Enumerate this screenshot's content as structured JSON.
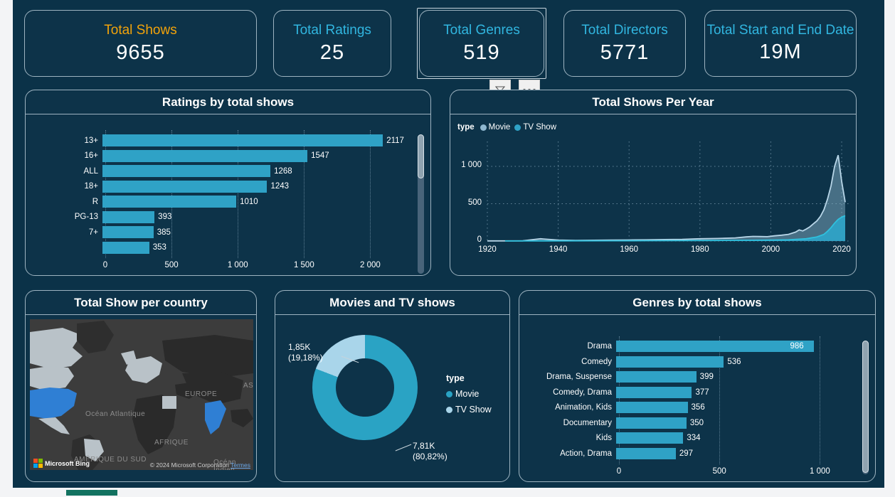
{
  "theme": {
    "canvas_bg": "#0b3248",
    "card_bg": "#0d3349",
    "card_border": "#9db3c0",
    "bar_color": "#2fa2c6",
    "accent_orange": "#f2a30a",
    "accent_cyan": "#31b6e0",
    "movie_color": "#8fb7cf",
    "tvshow_color": "#2fa2c6",
    "donut_movie": "#2aa3c4",
    "donut_tvshow": "#a9d5ea"
  },
  "kpis": [
    {
      "title": "Total Shows",
      "value": "9655",
      "title_color": "orange",
      "selected": false
    },
    {
      "title": "Total Ratings",
      "value": "25",
      "title_color": "cyan",
      "selected": false
    },
    {
      "title": "Total Genres",
      "value": "519",
      "title_color": "cyan",
      "selected": true
    },
    {
      "title": "Total Directors",
      "value": "5771",
      "title_color": "cyan",
      "selected": false
    },
    {
      "title": "Total Start and End Date",
      "value": "19M",
      "title_color": "cyan",
      "selected": false
    }
  ],
  "toolbar": {
    "filter_icon": "filter-funnel-icon",
    "more_icon": "more-options-icon"
  },
  "ratings_card": {
    "title": "Ratings by total shows"
  },
  "year_card": {
    "title": "Total Shows Per Year"
  },
  "map_card": {
    "title": "Total Show per country",
    "labels": [
      "EUROPE",
      "ASIE",
      "AFRIQUE",
      "Océan Atlantique",
      "AMÉRIQUE DU SUD",
      "Océan Indien"
    ],
    "provider": "Microsoft Bing",
    "credit": "© 2024 Microsoft Corporation",
    "terms_link": "Termes"
  },
  "donut_card": {
    "title": "Movies and TV shows"
  },
  "genres_card": {
    "title": "Genres by total shows"
  },
  "chart_data": [
    {
      "id": "ratings_by_total_shows",
      "type": "bar",
      "orientation": "horizontal",
      "title": "Ratings by total shows",
      "xlabel": "",
      "ylabel": "",
      "categories": [
        "13+",
        "16+",
        "ALL",
        "18+",
        "R",
        "PG-13",
        "7+",
        ""
      ],
      "values": [
        2117,
        1547,
        1268,
        1243,
        1010,
        393,
        385,
        353
      ],
      "xlim": [
        0,
        2250
      ],
      "ticks": [
        "0",
        "500",
        "1 000",
        "1 500",
        "2 000"
      ],
      "tick_values": [
        0,
        500,
        1000,
        1500,
        2000
      ],
      "grid": true,
      "scrollable": true
    },
    {
      "id": "total_shows_per_year",
      "type": "area",
      "title": "Total Shows Per Year",
      "legend_title": "type",
      "legend_position": "top-left",
      "xlabel": "",
      "ylabel": "",
      "xlim": [
        1920,
        2022
      ],
      "ylim": [
        0,
        1200
      ],
      "yticks": [
        "0",
        "500",
        "1 000"
      ],
      "ytick_values": [
        0,
        500,
        1000
      ],
      "xticks": [
        "1920",
        "1940",
        "1960",
        "1980",
        "2000",
        "2020"
      ],
      "xtick_values": [
        1920,
        1940,
        1960,
        1980,
        2000,
        2020
      ],
      "grid": true,
      "series": [
        {
          "name": "Movie",
          "color": "#8fb7cf",
          "x": [
            1920,
            1930,
            1935,
            1940,
            1945,
            1950,
            1955,
            1960,
            1965,
            1970,
            1975,
            1980,
            1985,
            1990,
            1993,
            1995,
            1997,
            1999,
            2001,
            2003,
            2005,
            2007,
            2008,
            2009,
            2010,
            2011,
            2012,
            2013,
            2014,
            2015,
            2016,
            2017,
            2018,
            2019,
            2020,
            2021
          ],
          "values": [
            2,
            3,
            30,
            12,
            8,
            10,
            12,
            14,
            16,
            20,
            22,
            30,
            34,
            42,
            55,
            62,
            60,
            58,
            70,
            78,
            90,
            120,
            150,
            135,
            160,
            190,
            230,
            270,
            330,
            420,
            560,
            740,
            1000,
            1150,
            800,
            520
          ]
        },
        {
          "name": "TV Show",
          "color": "#2fa2c6",
          "x": [
            1925,
            1935,
            1945,
            1955,
            1965,
            1975,
            1985,
            1995,
            2000,
            2005,
            2010,
            2013,
            2015,
            2016,
            2017,
            2018,
            2019,
            2020,
            2021
          ],
          "values": [
            1,
            2,
            3,
            4,
            5,
            6,
            8,
            10,
            12,
            16,
            30,
            55,
            90,
            130,
            180,
            240,
            290,
            320,
            340
          ]
        }
      ]
    },
    {
      "id": "movies_and_tv_shows",
      "type": "pie",
      "variant": "donut",
      "title": "Movies and TV shows",
      "legend_title": "type",
      "legend_position": "right",
      "labels": [
        "Movie",
        "TV Show"
      ],
      "values": [
        7810,
        1850
      ],
      "value_labels": [
        "7,81K",
        "1,85K"
      ],
      "percent_labels": [
        "(80,82%)",
        "(19,18%)"
      ],
      "percents": [
        80.82,
        19.18
      ],
      "colors": [
        "#2aa3c4",
        "#a9d5ea"
      ]
    },
    {
      "id": "genres_by_total_shows",
      "type": "bar",
      "orientation": "horizontal",
      "title": "Genres by total shows",
      "xlabel": "",
      "ylabel": "",
      "categories": [
        "Drama",
        "Comedy",
        "Drama, Suspense",
        "Comedy, Drama",
        "Animation, Kids",
        "Documentary",
        "Kids",
        "Action, Drama"
      ],
      "values": [
        986,
        536,
        399,
        377,
        356,
        350,
        334,
        297
      ],
      "xlim": [
        0,
        1080
      ],
      "ticks": [
        "0",
        "500",
        "1 000"
      ],
      "tick_values": [
        0,
        500,
        1000
      ],
      "grid": true,
      "scrollable": true
    }
  ]
}
